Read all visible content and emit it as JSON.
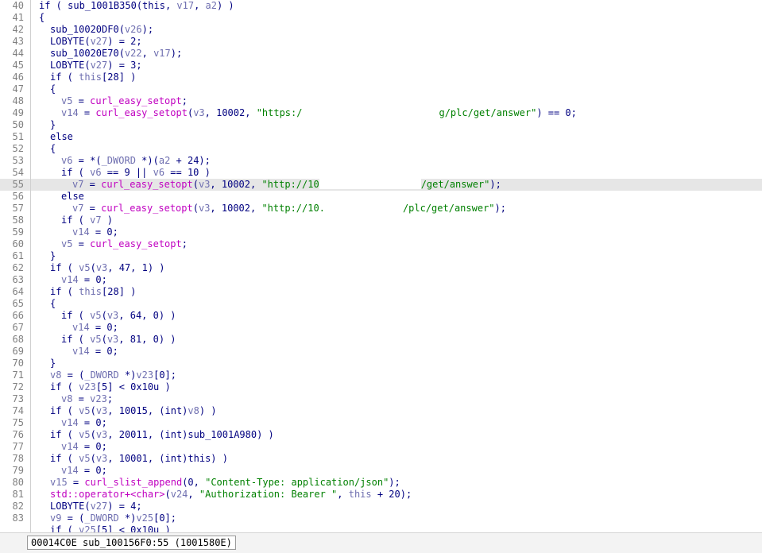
{
  "colors": {
    "keyword": "#000080",
    "variable": "#6f6fb0",
    "function": "#c000c0",
    "string": "#008000",
    "line_number": "#808080",
    "current_line_bg": "#e6e6e6"
  },
  "editor": {
    "current_line": 55,
    "lines": [
      {
        "n": "40",
        "indent": 0,
        "tokens": [
          {
            "t": "k",
            "s": "if ( sub_1001B350(this, "
          },
          {
            "t": "v",
            "s": "v17"
          },
          {
            "t": "k",
            "s": ", "
          },
          {
            "t": "v",
            "s": "a2"
          },
          {
            "t": "k",
            "s": ") )"
          }
        ]
      },
      {
        "n": "41",
        "indent": 0,
        "tokens": [
          {
            "t": "k",
            "s": "{"
          }
        ]
      },
      {
        "n": "42",
        "indent": 1,
        "tokens": [
          {
            "t": "k",
            "s": "sub_10020DF0("
          },
          {
            "t": "v",
            "s": "v26"
          },
          {
            "t": "k",
            "s": ");"
          }
        ]
      },
      {
        "n": "43",
        "indent": 1,
        "tokens": [
          {
            "t": "k",
            "s": "LOBYTE("
          },
          {
            "t": "v",
            "s": "v27"
          },
          {
            "t": "k",
            "s": ") = 2;"
          }
        ]
      },
      {
        "n": "44",
        "indent": 1,
        "tokens": [
          {
            "t": "k",
            "s": "sub_10020E70("
          },
          {
            "t": "v",
            "s": "v22"
          },
          {
            "t": "k",
            "s": ", "
          },
          {
            "t": "v",
            "s": "v17"
          },
          {
            "t": "k",
            "s": ");"
          }
        ]
      },
      {
        "n": "45",
        "indent": 1,
        "tokens": [
          {
            "t": "k",
            "s": "LOBYTE("
          },
          {
            "t": "v",
            "s": "v27"
          },
          {
            "t": "k",
            "s": ") = 3;"
          }
        ]
      },
      {
        "n": "46",
        "indent": 1,
        "tokens": [
          {
            "t": "k",
            "s": "if ( "
          },
          {
            "t": "v",
            "s": "this"
          },
          {
            "t": "k",
            "s": "[28] )"
          }
        ]
      },
      {
        "n": "47",
        "indent": 1,
        "tokens": [
          {
            "t": "k",
            "s": "{"
          }
        ]
      },
      {
        "n": "48",
        "indent": 2,
        "tokens": [
          {
            "t": "v",
            "s": "v5"
          },
          {
            "t": "k",
            "s": " = "
          },
          {
            "t": "f",
            "s": "curl_easy_setopt"
          },
          {
            "t": "k",
            "s": ";"
          }
        ]
      },
      {
        "n": "49",
        "indent": 2,
        "tokens": [
          {
            "t": "v",
            "s": "v14"
          },
          {
            "t": "k",
            "s": " = "
          },
          {
            "t": "f",
            "s": "curl_easy_setopt"
          },
          {
            "t": "k",
            "s": "("
          },
          {
            "t": "v",
            "s": "v3"
          },
          {
            "t": "k",
            "s": ", 10002, "
          },
          {
            "t": "s",
            "s": "\"https:/"
          },
          {
            "t": "r",
            "s": "",
            "w": 172
          },
          {
            "t": "s",
            "s": "g/plc/get/answer\""
          },
          {
            "t": "k",
            "s": ") == 0;"
          }
        ]
      },
      {
        "n": "50",
        "indent": 1,
        "tokens": [
          {
            "t": "k",
            "s": "}"
          }
        ]
      },
      {
        "n": "51",
        "indent": 1,
        "tokens": [
          {
            "t": "k",
            "s": "else"
          }
        ]
      },
      {
        "n": "52",
        "indent": 1,
        "tokens": [
          {
            "t": "k",
            "s": "{"
          }
        ]
      },
      {
        "n": "53",
        "indent": 2,
        "tokens": [
          {
            "t": "v",
            "s": "v6"
          },
          {
            "t": "k",
            "s": " = *("
          },
          {
            "t": "v",
            "s": "_DWORD"
          },
          {
            "t": "k",
            "s": " *)("
          },
          {
            "t": "v",
            "s": "a2"
          },
          {
            "t": "k",
            "s": " + 24);"
          }
        ]
      },
      {
        "n": "54",
        "indent": 2,
        "tokens": [
          {
            "t": "k",
            "s": "if ( "
          },
          {
            "t": "v",
            "s": "v6"
          },
          {
            "t": "k",
            "s": " == 9 || "
          },
          {
            "t": "v",
            "s": "v6"
          },
          {
            "t": "k",
            "s": " == 10 )"
          }
        ]
      },
      {
        "n": "55",
        "indent": 3,
        "tokens": [
          {
            "t": "v",
            "s": "v7"
          },
          {
            "t": "k",
            "s": " = "
          },
          {
            "t": "f",
            "s": "curl_easy_setopt"
          },
          {
            "t": "k",
            "s": "("
          },
          {
            "t": "v",
            "s": "v3"
          },
          {
            "t": "k",
            "s": ", 10002, "
          },
          {
            "t": "s",
            "s": "\"http://10"
          },
          {
            "t": "r",
            "s": "",
            "w": 128
          },
          {
            "t": "s",
            "s": "/get/answer\""
          },
          {
            "t": "k",
            "s": ");"
          }
        ]
      },
      {
        "n": "56",
        "indent": 2,
        "tokens": [
          {
            "t": "k",
            "s": "else"
          }
        ]
      },
      {
        "n": "57",
        "indent": 3,
        "tokens": [
          {
            "t": "v",
            "s": "v7"
          },
          {
            "t": "k",
            "s": " = "
          },
          {
            "t": "f",
            "s": "curl_easy_setopt"
          },
          {
            "t": "k",
            "s": "("
          },
          {
            "t": "v",
            "s": "v3"
          },
          {
            "t": "k",
            "s": ", 10002, "
          },
          {
            "t": "s",
            "s": "\"http://10."
          },
          {
            "t": "r",
            "s": "",
            "w": 98
          },
          {
            "t": "s",
            "s": "/plc/get/answer\""
          },
          {
            "t": "k",
            "s": ");"
          }
        ]
      },
      {
        "n": "58",
        "indent": 2,
        "tokens": [
          {
            "t": "k",
            "s": "if ( "
          },
          {
            "t": "v",
            "s": "v7"
          },
          {
            "t": "k",
            "s": " )"
          }
        ]
      },
      {
        "n": "59",
        "indent": 3,
        "tokens": [
          {
            "t": "v",
            "s": "v14"
          },
          {
            "t": "k",
            "s": " = 0;"
          }
        ]
      },
      {
        "n": "60",
        "indent": 2,
        "tokens": [
          {
            "t": "v",
            "s": "v5"
          },
          {
            "t": "k",
            "s": " = "
          },
          {
            "t": "f",
            "s": "curl_easy_setopt"
          },
          {
            "t": "k",
            "s": ";"
          }
        ]
      },
      {
        "n": "61",
        "indent": 1,
        "tokens": [
          {
            "t": "k",
            "s": "}"
          }
        ]
      },
      {
        "n": "62",
        "indent": 1,
        "tokens": [
          {
            "t": "k",
            "s": "if ( "
          },
          {
            "t": "v",
            "s": "v5"
          },
          {
            "t": "k",
            "s": "("
          },
          {
            "t": "v",
            "s": "v3"
          },
          {
            "t": "k",
            "s": ", 47, 1) )"
          }
        ]
      },
      {
        "n": "63",
        "indent": 2,
        "tokens": [
          {
            "t": "v",
            "s": "v14"
          },
          {
            "t": "k",
            "s": " = 0;"
          }
        ]
      },
      {
        "n": "64",
        "indent": 1,
        "tokens": [
          {
            "t": "k",
            "s": "if ( "
          },
          {
            "t": "v",
            "s": "this"
          },
          {
            "t": "k",
            "s": "[28] )"
          }
        ]
      },
      {
        "n": "65",
        "indent": 1,
        "tokens": [
          {
            "t": "k",
            "s": "{"
          }
        ]
      },
      {
        "n": "66",
        "indent": 2,
        "tokens": [
          {
            "t": "k",
            "s": "if ( "
          },
          {
            "t": "v",
            "s": "v5"
          },
          {
            "t": "k",
            "s": "("
          },
          {
            "t": "v",
            "s": "v3"
          },
          {
            "t": "k",
            "s": ", 64, 0) )"
          }
        ]
      },
      {
        "n": "67",
        "indent": 3,
        "tokens": [
          {
            "t": "v",
            "s": "v14"
          },
          {
            "t": "k",
            "s": " = 0;"
          }
        ]
      },
      {
        "n": "68",
        "indent": 2,
        "tokens": [
          {
            "t": "k",
            "s": "if ( "
          },
          {
            "t": "v",
            "s": "v5"
          },
          {
            "t": "k",
            "s": "("
          },
          {
            "t": "v",
            "s": "v3"
          },
          {
            "t": "k",
            "s": ", 81, 0) )"
          }
        ]
      },
      {
        "n": "69",
        "indent": 3,
        "tokens": [
          {
            "t": "v",
            "s": "v14"
          },
          {
            "t": "k",
            "s": " = 0;"
          }
        ]
      },
      {
        "n": "70",
        "indent": 1,
        "tokens": [
          {
            "t": "k",
            "s": "}"
          }
        ]
      },
      {
        "n": "71",
        "indent": 1,
        "tokens": [
          {
            "t": "v",
            "s": "v8"
          },
          {
            "t": "k",
            "s": " = ("
          },
          {
            "t": "v",
            "s": "_DWORD"
          },
          {
            "t": "k",
            "s": " *)"
          },
          {
            "t": "v",
            "s": "v23"
          },
          {
            "t": "k",
            "s": "[0];"
          }
        ]
      },
      {
        "n": "72",
        "indent": 1,
        "tokens": [
          {
            "t": "k",
            "s": "if ( "
          },
          {
            "t": "v",
            "s": "v23"
          },
          {
            "t": "k",
            "s": "[5] < 0x10u )"
          }
        ]
      },
      {
        "n": "73",
        "indent": 2,
        "tokens": [
          {
            "t": "v",
            "s": "v8"
          },
          {
            "t": "k",
            "s": " = "
          },
          {
            "t": "v",
            "s": "v23"
          },
          {
            "t": "k",
            "s": ";"
          }
        ]
      },
      {
        "n": "74",
        "indent": 1,
        "tokens": [
          {
            "t": "k",
            "s": "if ( "
          },
          {
            "t": "v",
            "s": "v5"
          },
          {
            "t": "k",
            "s": "("
          },
          {
            "t": "v",
            "s": "v3"
          },
          {
            "t": "k",
            "s": ", 10015, (int)"
          },
          {
            "t": "v",
            "s": "v8"
          },
          {
            "t": "k",
            "s": ") )"
          }
        ]
      },
      {
        "n": "75",
        "indent": 2,
        "tokens": [
          {
            "t": "v",
            "s": "v14"
          },
          {
            "t": "k",
            "s": " = 0;"
          }
        ]
      },
      {
        "n": "76",
        "indent": 1,
        "tokens": [
          {
            "t": "k",
            "s": "if ( "
          },
          {
            "t": "v",
            "s": "v5"
          },
          {
            "t": "k",
            "s": "("
          },
          {
            "t": "v",
            "s": "v3"
          },
          {
            "t": "k",
            "s": ", 20011, (int)sub_1001A980) )"
          }
        ]
      },
      {
        "n": "77",
        "indent": 2,
        "tokens": [
          {
            "t": "v",
            "s": "v14"
          },
          {
            "t": "k",
            "s": " = 0;"
          }
        ]
      },
      {
        "n": "78",
        "indent": 1,
        "tokens": [
          {
            "t": "k",
            "s": "if ( "
          },
          {
            "t": "v",
            "s": "v5"
          },
          {
            "t": "k",
            "s": "("
          },
          {
            "t": "v",
            "s": "v3"
          },
          {
            "t": "k",
            "s": ", 10001, (int)this) )"
          }
        ]
      },
      {
        "n": "79",
        "indent": 2,
        "tokens": [
          {
            "t": "v",
            "s": "v14"
          },
          {
            "t": "k",
            "s": " = 0;"
          }
        ]
      },
      {
        "n": "80",
        "indent": 1,
        "tokens": [
          {
            "t": "v",
            "s": "v15"
          },
          {
            "t": "k",
            "s": " = "
          },
          {
            "t": "f",
            "s": "curl_slist_append"
          },
          {
            "t": "k",
            "s": "(0, "
          },
          {
            "t": "s",
            "s": "\"Content-Type: application/json\""
          },
          {
            "t": "k",
            "s": ");"
          }
        ]
      },
      {
        "n": "81",
        "indent": 1,
        "tokens": [
          {
            "t": "f",
            "s": "std::operator+<char>"
          },
          {
            "t": "k",
            "s": "("
          },
          {
            "t": "v",
            "s": "v24"
          },
          {
            "t": "k",
            "s": ", "
          },
          {
            "t": "s",
            "s": "\"Authorization: Bearer \""
          },
          {
            "t": "k",
            "s": ", "
          },
          {
            "t": "v",
            "s": "this"
          },
          {
            "t": "k",
            "s": " + 20);"
          }
        ]
      },
      {
        "n": "82",
        "indent": 1,
        "tokens": [
          {
            "t": "k",
            "s": "LOBYTE("
          },
          {
            "t": "v",
            "s": "v27"
          },
          {
            "t": "k",
            "s": ") = 4;"
          }
        ]
      },
      {
        "n": "83",
        "indent": 1,
        "tokens": [
          {
            "t": "v",
            "s": "v9"
          },
          {
            "t": "k",
            "s": " = ("
          },
          {
            "t": "v",
            "s": "_DWORD"
          },
          {
            "t": "k",
            "s": " *)"
          },
          {
            "t": "v",
            "s": "v25"
          },
          {
            "t": "k",
            "s": "[0];"
          }
        ]
      },
      {
        "n": "",
        "indent": 1,
        "tokens": [
          {
            "t": "k",
            "s": "if ( "
          },
          {
            "t": "v",
            "s": "v25"
          },
          {
            "t": "k",
            "s": "[5] < 0x10u )"
          }
        ]
      }
    ]
  },
  "status_bar": {
    "text": "00014C0E sub_100156F0:55 (1001580E)"
  }
}
